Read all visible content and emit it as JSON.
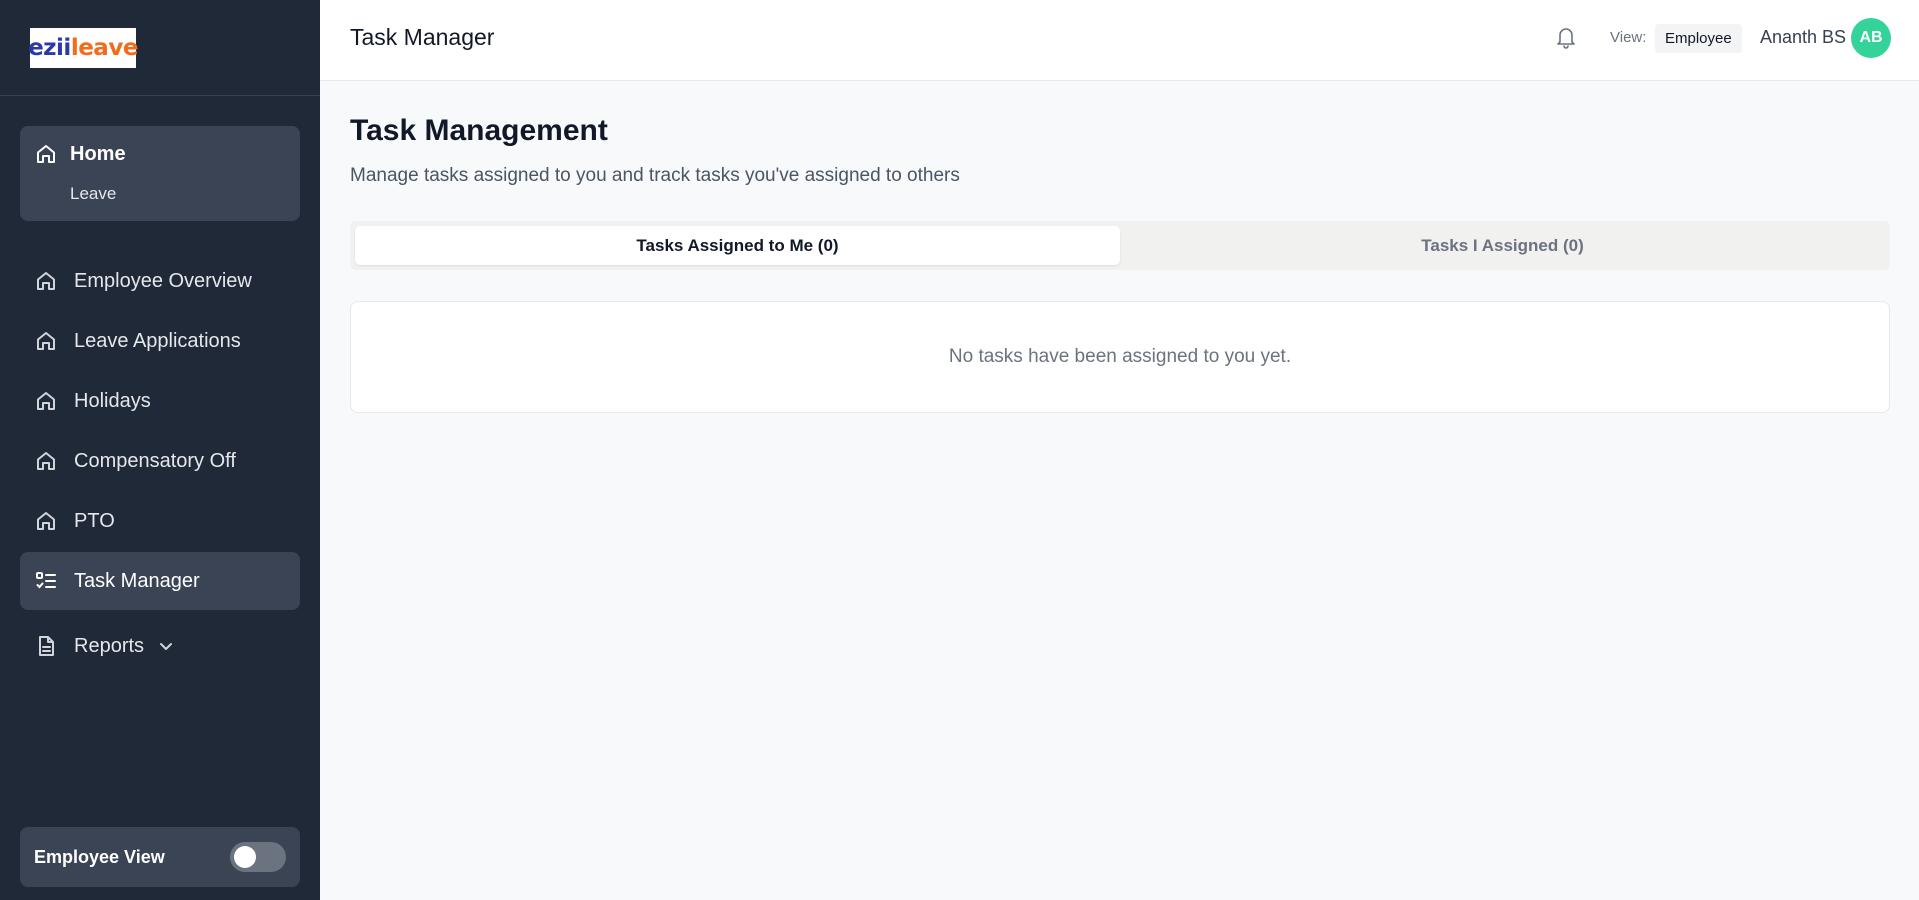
{
  "sidebar": {
    "logo": {
      "part1": "ezii",
      "part2": "leave"
    },
    "home": {
      "label": "Home",
      "sub": "Leave"
    },
    "items": [
      {
        "label": "Employee Overview",
        "icon": "home-icon"
      },
      {
        "label": "Leave Applications",
        "icon": "home-icon"
      },
      {
        "label": "Holidays",
        "icon": "home-icon"
      },
      {
        "label": "Compensatory Off",
        "icon": "home-icon"
      },
      {
        "label": "PTO",
        "icon": "home-icon"
      },
      {
        "label": "Task Manager",
        "icon": "task-list-icon",
        "active": true
      },
      {
        "label": "Reports",
        "icon": "document-icon",
        "expandable": true
      }
    ],
    "employee_view": {
      "label": "Employee View",
      "enabled": false
    }
  },
  "header": {
    "title": "Task Manager",
    "view_label": "View:",
    "view_value": "Employee",
    "user_name": "Ananth BS",
    "avatar_initials": "AB"
  },
  "main": {
    "title": "Task Management",
    "subtitle": "Manage tasks assigned to you and track tasks you've assigned to others",
    "tabs": [
      {
        "label": "Tasks Assigned to Me (0)",
        "active": true
      },
      {
        "label": "Tasks I Assigned (0)",
        "active": false
      }
    ],
    "empty_message": "No tasks have been assigned to you yet."
  },
  "colors": {
    "sidebar_bg": "#1f2937",
    "sidebar_active": "#3a4455",
    "avatar": "#34d399",
    "logo_blue": "#2b3aa8",
    "logo_orange": "#f26c1b"
  }
}
